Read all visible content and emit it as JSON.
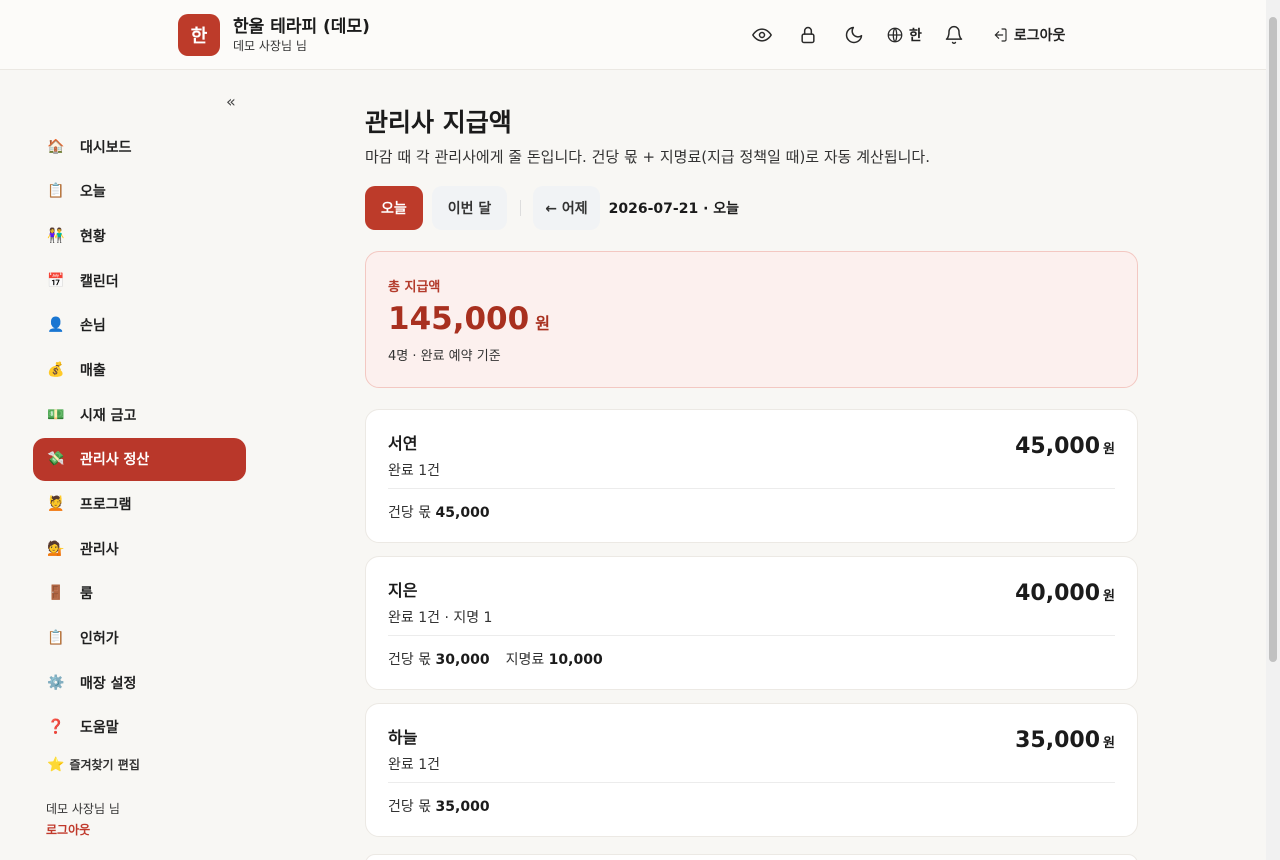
{
  "header": {
    "logo_char": "한",
    "title": "한울 테라피 (데모)",
    "subtitle": "데모 사장님 님",
    "lang_label": "한",
    "logout_label": "로그아웃"
  },
  "sidebar": {
    "collapse_glyph": "«",
    "items": [
      {
        "icon": "🏠",
        "label": "대시보드"
      },
      {
        "icon": "📋",
        "label": "오늘"
      },
      {
        "icon": "👫",
        "label": "현황"
      },
      {
        "icon": "📅",
        "label": "캘린더"
      },
      {
        "icon": "👤",
        "label": "손님"
      },
      {
        "icon": "💰",
        "label": "매출"
      },
      {
        "icon": "💵",
        "label": "시재 금고"
      },
      {
        "icon": "💸",
        "label": "관리사 정산"
      },
      {
        "icon": "💆",
        "label": "프로그램"
      },
      {
        "icon": "💁",
        "label": "관리사"
      },
      {
        "icon": "🚪",
        "label": "룸"
      },
      {
        "icon": "📋",
        "label": "인허가"
      },
      {
        "icon": "⚙️",
        "label": "매장 설정"
      },
      {
        "icon": "❓",
        "label": "도움말"
      }
    ],
    "active_index": 7,
    "favorites_icon": "⭐",
    "favorites_label": "즐겨찾기 편집",
    "user_name": "데모 사장님 님",
    "logout_label": "로그아웃"
  },
  "main": {
    "title": "관리사 지급액",
    "description": "마감 때 각 관리사에게 줄 돈입니다. 건당 몫 + 지명료(지급 정책일 때)로 자동 계산됩니다.",
    "btn_today": "오늘",
    "btn_this_month": "이번 달",
    "btn_prev": "← 어제",
    "date_label": "2026-07-21 · 오늘",
    "total": {
      "label": "총 지급액",
      "amount": "145,000",
      "unit": "원",
      "sub": "4명 · 완료 예약 기준"
    },
    "staff": [
      {
        "name": "서연",
        "count": "완료 1건",
        "amount": "45,000",
        "unit": "원",
        "share_label": "건당 몫",
        "share_value": "45,000",
        "fee_label": "",
        "fee_value": ""
      },
      {
        "name": "지은",
        "count": "완료 1건 · 지명 1",
        "amount": "40,000",
        "unit": "원",
        "share_label": "건당 몫",
        "share_value": "30,000",
        "fee_label": "지명료",
        "fee_value": "10,000"
      },
      {
        "name": "하늘",
        "count": "완료 1건",
        "amount": "35,000",
        "unit": "원",
        "share_label": "건당 몫",
        "share_value": "35,000",
        "fee_label": "",
        "fee_value": ""
      }
    ]
  },
  "colors": {
    "accent": "#bd3b2a",
    "total_bg": "#fcf0ee",
    "total_text": "#a8301f"
  }
}
